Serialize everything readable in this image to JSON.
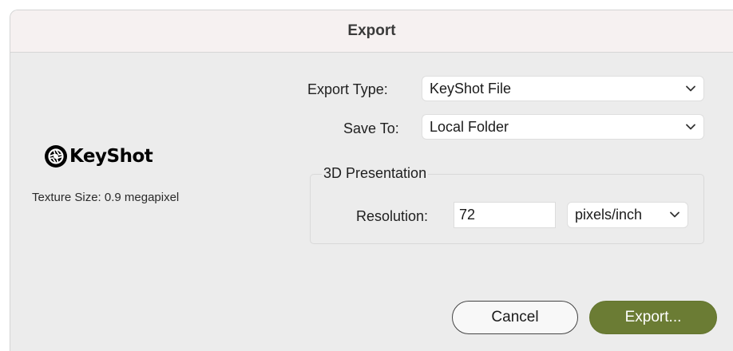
{
  "window": {
    "title": "Export"
  },
  "logo": {
    "brand": "KeyShot",
    "icon": "keyshot-logo-icon"
  },
  "info": {
    "texture_size": "Texture Size: 0.9 megapixel"
  },
  "export_type": {
    "label": "Export Type:",
    "value": "KeyShot File",
    "icon": "chevron-down-icon"
  },
  "save_to": {
    "label": "Save To:",
    "value": "Local Folder",
    "icon": "chevron-down-icon"
  },
  "presentation": {
    "group_title": "3D Presentation",
    "resolution_label": "Resolution:",
    "resolution_value": "72",
    "unit_value": "pixels/inch",
    "icon": "chevron-down-icon"
  },
  "buttons": {
    "cancel": "Cancel",
    "export": "Export..."
  },
  "colors": {
    "primary_button": "#6b7c34",
    "dialog_background": "#ececec",
    "titlebar_background": "#f6f1f1"
  }
}
